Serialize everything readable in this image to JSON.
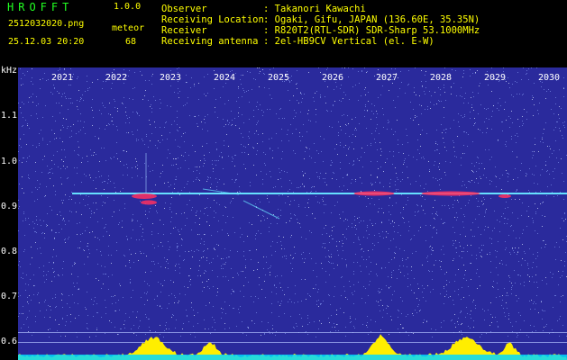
{
  "header": {
    "app_name": "HROFFT",
    "version": "1.0.0",
    "filename": "2512032020.png",
    "meteor_label": "meteor",
    "datetime": "25.12.03 20:20",
    "meteor_count": "68",
    "fields": [
      {
        "label": "Observer",
        "value": ": Takanori Kawachi"
      },
      {
        "label": "Receiving Location",
        "value": ": Ogaki, Gifu, JAPAN (136.60E, 35.35N)"
      },
      {
        "label": "Receiver",
        "value": ": R820T2(RTL-SDR) SDR-Sharp 53.1000MHz"
      },
      {
        "label": "Receiving antenna",
        "value": ": 2el-HB9CV Vertical (el. E-W)"
      }
    ]
  },
  "spectrogram": {
    "y_unit": "kHz",
    "y_ticks": [
      "1.1",
      "1.0",
      "0.9",
      "0.8",
      "0.7",
      "0.6"
    ],
    "x_ticks": [
      "2021",
      "2022",
      "2023",
      "2024",
      "2025",
      "2026",
      "2027",
      "2028",
      "2029",
      "2030"
    ],
    "colors": {
      "background": "#2a2a9c",
      "carrier": "#66e0ff",
      "burst": "#ff3060",
      "activity": "#ffee00",
      "baseline": "#00d8ff"
    }
  }
}
